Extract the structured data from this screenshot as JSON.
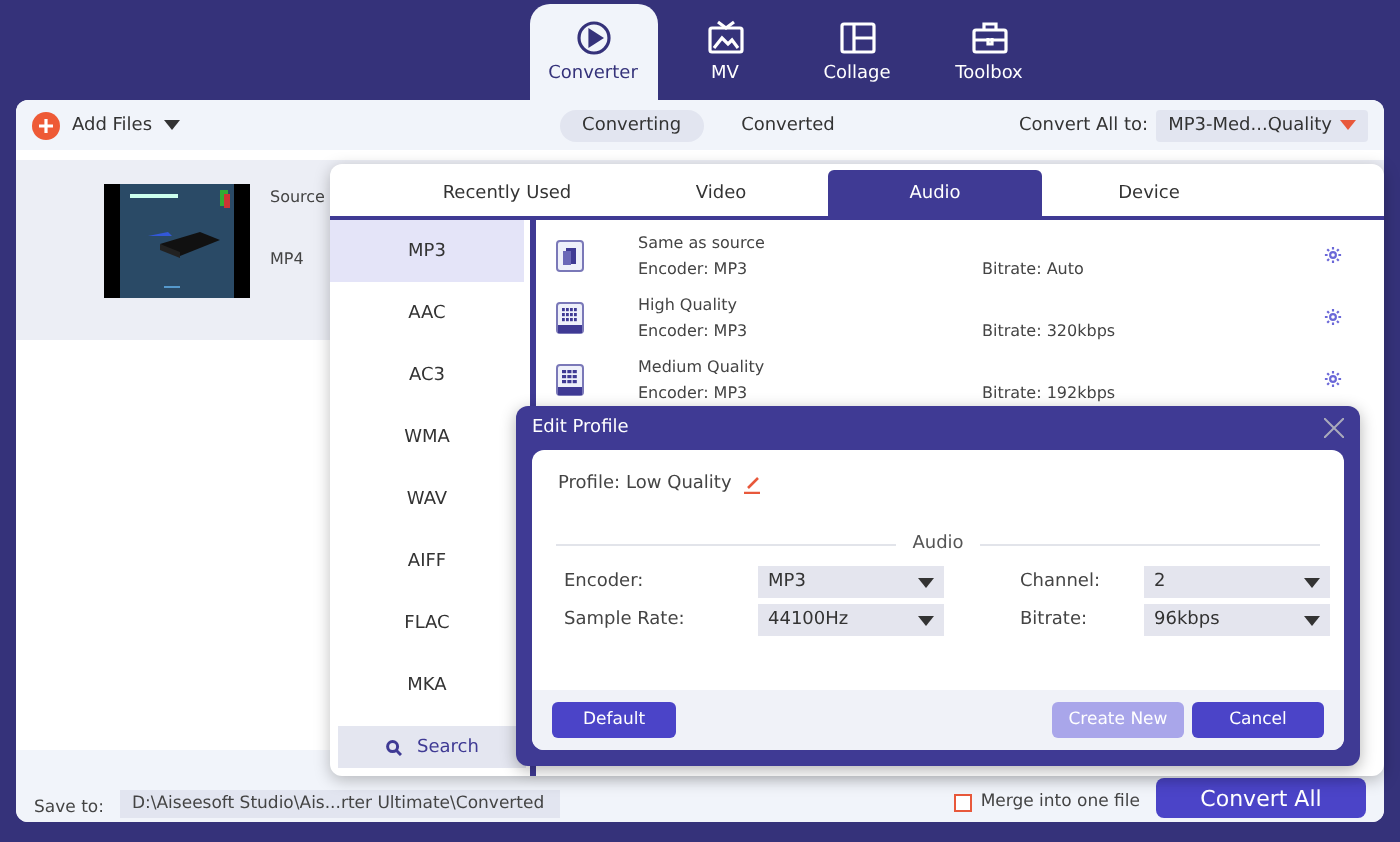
{
  "nav": {
    "tabs": [
      {
        "label": "Converter",
        "selected": true,
        "kind": "converter"
      },
      {
        "label": "MV",
        "selected": false,
        "kind": "mv"
      },
      {
        "label": "Collage",
        "selected": false,
        "kind": "collage"
      },
      {
        "label": "Toolbox",
        "selected": false,
        "kind": "toolbox"
      }
    ]
  },
  "toolbar": {
    "add_files": "Add Files",
    "views": [
      {
        "label": "Converting",
        "selected": true
      },
      {
        "label": "Converted",
        "selected": false
      }
    ],
    "convert_all_label": "Convert All to:",
    "convert_all_value": "MP3-Med...Quality"
  },
  "file": {
    "source_label": "Source",
    "format": "MP4"
  },
  "bottom": {
    "save_to_label": "Save to:",
    "save_path": "D:\\Aiseesoft Studio\\Ais...rter Ultimate\\Converted",
    "merge_label": "Merge into one file",
    "merge_checked": false,
    "convert_button": "Convert All"
  },
  "format_popup": {
    "tabs": [
      {
        "label": "Recently Used",
        "selected": false
      },
      {
        "label": "Video",
        "selected": false
      },
      {
        "label": "Audio",
        "selected": true
      },
      {
        "label": "Device",
        "selected": false
      }
    ],
    "formats": [
      {
        "label": "MP3",
        "selected": true
      },
      {
        "label": "AAC",
        "selected": false
      },
      {
        "label": "AC3",
        "selected": false
      },
      {
        "label": "WMA",
        "selected": false
      },
      {
        "label": "WAV",
        "selected": false
      },
      {
        "label": "AIFF",
        "selected": false
      },
      {
        "label": "FLAC",
        "selected": false
      },
      {
        "label": "MKA",
        "selected": false
      }
    ],
    "search": "Search",
    "profiles": [
      {
        "name": "Same as source",
        "encoder": "Encoder: MP3",
        "bitrate": "Bitrate: Auto",
        "kind": "source"
      },
      {
        "name": "High Quality",
        "encoder": "Encoder: MP3",
        "bitrate": "Bitrate: 320kbps",
        "kind": "high"
      },
      {
        "name": "Medium Quality",
        "encoder": "Encoder: MP3",
        "bitrate": "Bitrate: 192kbps",
        "kind": "medium"
      }
    ]
  },
  "edit_profile": {
    "title": "Edit Profile",
    "profile_label": "Profile:",
    "profile_name": "Low Quality",
    "section": "Audio",
    "fields": [
      {
        "label": "Encoder:",
        "value": "MP3"
      },
      {
        "label": "Channel:",
        "value": "2"
      },
      {
        "label": "Sample Rate:",
        "value": "44100Hz"
      },
      {
        "label": "Bitrate:",
        "value": "96kbps"
      }
    ],
    "buttons": [
      {
        "label": "Default",
        "disabled": false
      },
      {
        "label": "Create New",
        "disabled": true
      },
      {
        "label": "Cancel",
        "disabled": false
      }
    ]
  }
}
